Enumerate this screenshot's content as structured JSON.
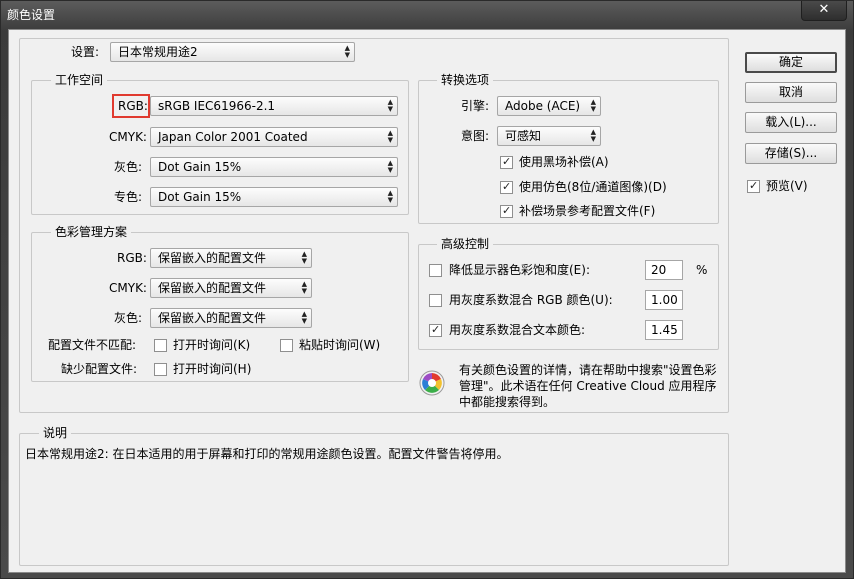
{
  "window": {
    "title": "颜色设置",
    "close_glyph": "✕"
  },
  "settings": {
    "label": "设置:",
    "value": "日本常规用途2"
  },
  "workspace": {
    "title": "工作空间",
    "rgb": {
      "label": "RGB:",
      "value": "sRGB IEC61966-2.1"
    },
    "cmyk": {
      "label": "CMYK:",
      "value": "Japan Color 2001 Coated"
    },
    "gray": {
      "label": "灰色:",
      "value": "Dot Gain 15%"
    },
    "spot": {
      "label": "专色:",
      "value": "Dot Gain 15%"
    }
  },
  "policies": {
    "title": "色彩管理方案",
    "rgb": {
      "label": "RGB:",
      "value": "保留嵌入的配置文件"
    },
    "cmyk": {
      "label": "CMYK:",
      "value": "保留嵌入的配置文件"
    },
    "gray": {
      "label": "灰色:",
      "value": "保留嵌入的配置文件"
    },
    "mismatch_label": "配置文件不匹配:",
    "mismatch_open": {
      "label": "打开时询问(K)",
      "checked": false
    },
    "mismatch_paste": {
      "label": "粘贴时询问(W)",
      "checked": false
    },
    "missing_label": "缺少配置文件:",
    "missing_open": {
      "label": "打开时询问(H)",
      "checked": false
    }
  },
  "conversion": {
    "title": "转换选项",
    "engine": {
      "label": "引擎:",
      "value": "Adobe (ACE)"
    },
    "intent": {
      "label": "意图:",
      "value": "可感知"
    },
    "black_point": {
      "label": "使用黑场补偿(A)",
      "checked": true
    },
    "dither": {
      "label": "使用仿色(8位/通道图像)(D)",
      "checked": true
    },
    "compensate": {
      "label": "补偿场景参考配置文件(F)",
      "checked": true
    }
  },
  "advanced": {
    "title": "高级控制",
    "desaturate": {
      "label": "降低显示器色彩饱和度(E):",
      "checked": false,
      "value": "20",
      "unit": "%"
    },
    "blend_rgb": {
      "label": "用灰度系数混合 RGB 颜色(U):",
      "checked": false,
      "value": "1.00"
    },
    "blend_text": {
      "label": "用灰度系数混合文本颜色:",
      "checked": true,
      "value": "1.45"
    }
  },
  "info": {
    "text": "有关颜色设置的详情，请在帮助中搜索\"设置色彩管理\"。此术语在任何 Creative Cloud 应用程序中都能搜索得到。",
    "icon": "color-wheel-icon"
  },
  "description": {
    "title": "说明",
    "text": "日本常规用途2: 在日本适用的用于屏幕和打印的常规用途颜色设置。配置文件警告将停用。"
  },
  "buttons": {
    "ok": "确定",
    "cancel": "取消",
    "load": "载入(L)...",
    "save": "存储(S)...",
    "preview": {
      "label": "预览(V)",
      "checked": true
    }
  },
  "colors": {
    "highlight": "#e03a2f",
    "dialog_bg": "#f0f0f0"
  }
}
